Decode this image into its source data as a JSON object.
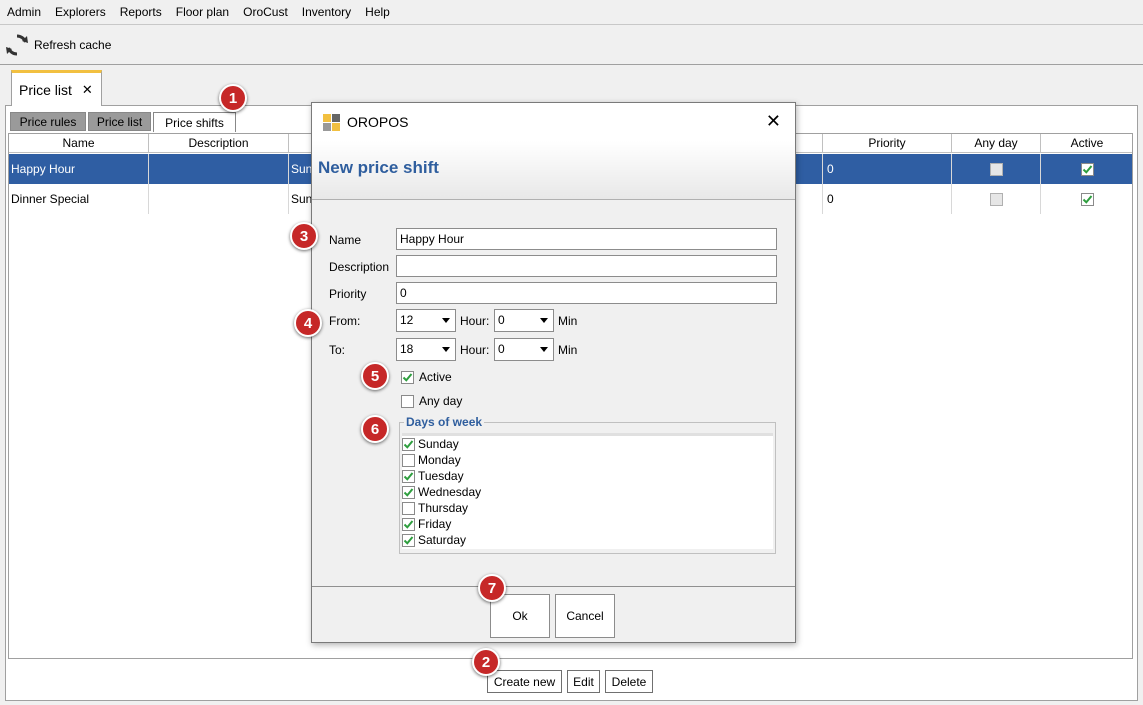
{
  "menubar": {
    "items": [
      "Admin",
      "Explorers",
      "Reports",
      "Floor plan",
      "OroCust",
      "Inventory",
      "Help"
    ]
  },
  "toolbar": {
    "refresh_label": "Refresh cache",
    "refresh_icon": "refresh-icon"
  },
  "main_tab": {
    "label": "Price list",
    "close": "✕"
  },
  "subtabs": [
    "Price rules",
    "Price list",
    "Price shifts"
  ],
  "table": {
    "columns": [
      "Name",
      "Description",
      "",
      "",
      "Priority",
      "Any day",
      "Active"
    ],
    "rows": [
      {
        "name": "Happy Hour",
        "description": "",
        "days": "Sun",
        "priority": "0",
        "any_day": false,
        "active": true
      },
      {
        "name": "Dinner Special",
        "description": "",
        "days": "Sun",
        "priority": "0",
        "any_day": false,
        "active": true
      }
    ]
  },
  "bottom_buttons": {
    "create": "Create new",
    "edit": "Edit",
    "delete": "Delete"
  },
  "dialog": {
    "app_title": "OROPOS",
    "close": "✕",
    "header_title": "New price shift",
    "fields": {
      "name_label": "Name",
      "name_value": "Happy Hour",
      "description_label": "Description",
      "description_value": "",
      "priority_label": "Priority",
      "priority_value": "0"
    },
    "from": {
      "label": "From:",
      "hour": "12",
      "hour_label": "Hour:",
      "min": "0",
      "min_label": "Min"
    },
    "to": {
      "label": "To:",
      "hour": "18",
      "hour_label": "Hour:",
      "min": "0",
      "min_label": "Min"
    },
    "active": {
      "label": "Active",
      "checked": true
    },
    "any_day": {
      "label": "Any day",
      "checked": false
    },
    "days_legend": "Days of week",
    "days": [
      {
        "label": "Sunday",
        "checked": true
      },
      {
        "label": "Monday",
        "checked": false
      },
      {
        "label": "Tuesday",
        "checked": true
      },
      {
        "label": "Wednesday",
        "checked": true
      },
      {
        "label": "Thursday",
        "checked": false
      },
      {
        "label": "Friday",
        "checked": true
      },
      {
        "label": "Saturday",
        "checked": true
      }
    ],
    "ok_label": "Ok",
    "cancel_label": "Cancel"
  },
  "badges": [
    "1",
    "2",
    "3",
    "4",
    "5",
    "6",
    "7"
  ],
  "colors": {
    "selection": "#2f5ea3",
    "header_blue": "#2f5e9e",
    "badge_red": "#c62828",
    "tab_accent": "#f2c040",
    "check_green": "#2e9e3e"
  }
}
